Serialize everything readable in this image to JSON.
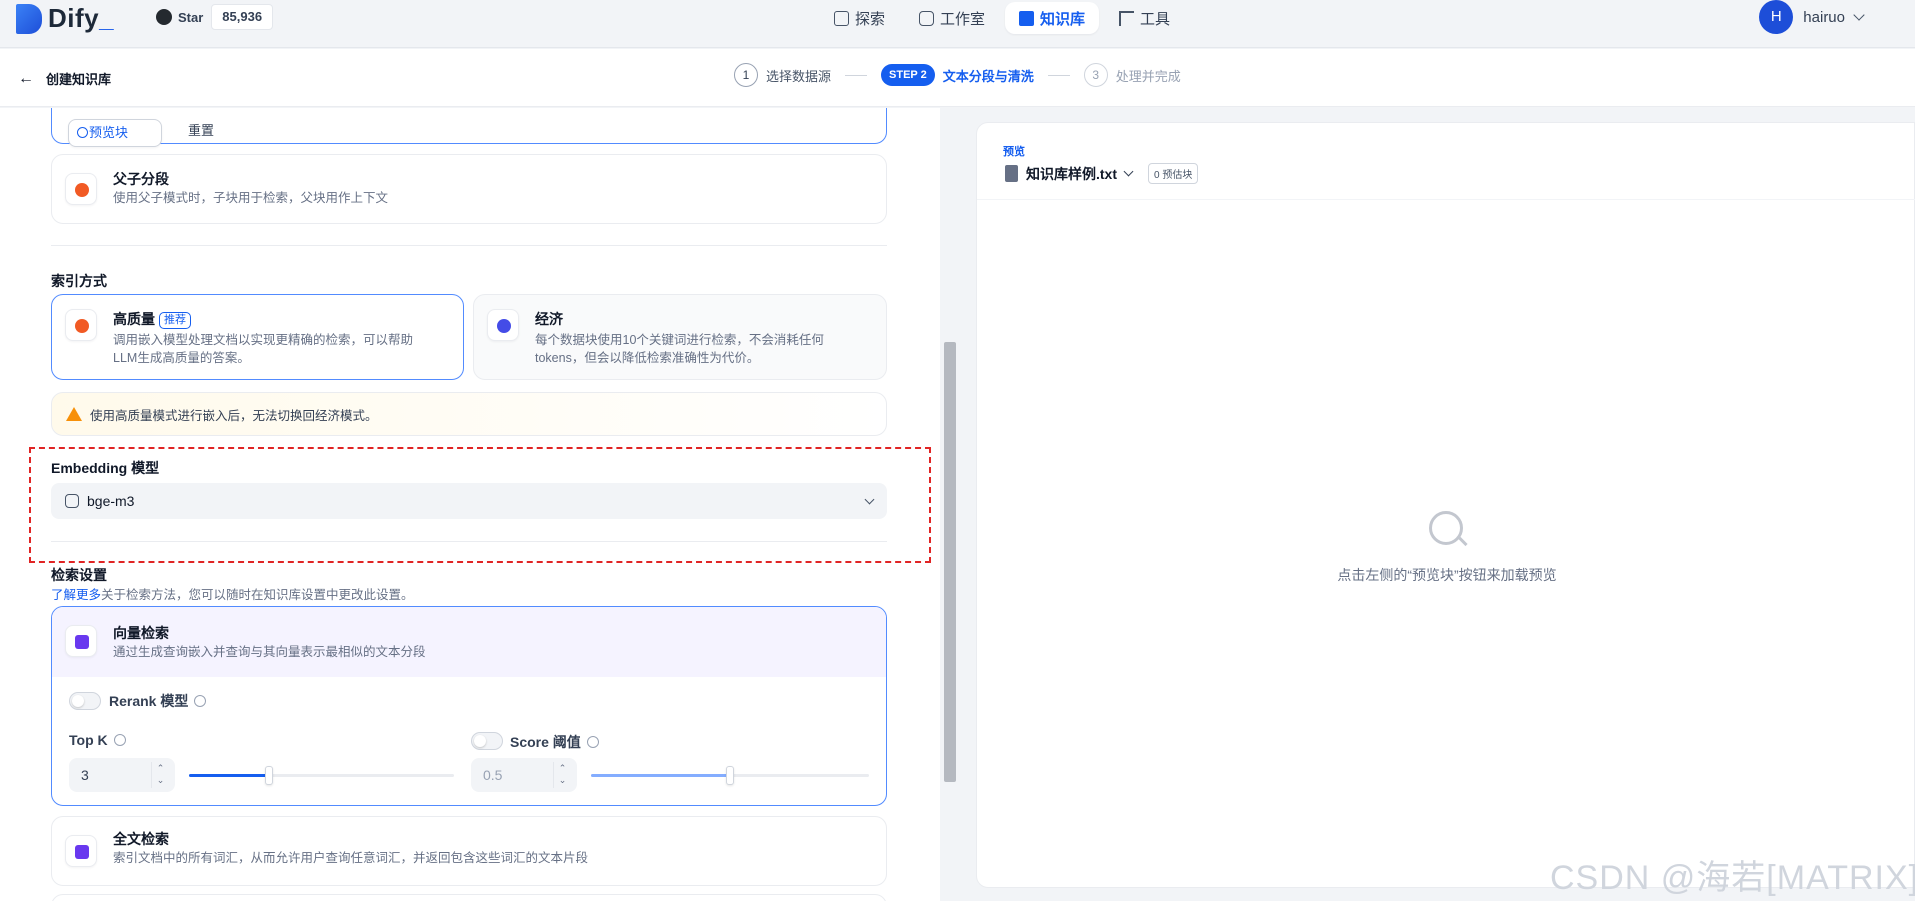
{
  "app": {
    "name": "Dify",
    "underscore": "_"
  },
  "github": {
    "label": "Star",
    "count": "85,936"
  },
  "nav": [
    {
      "label": "探索",
      "icon": "explore-icon"
    },
    {
      "label": "工作室",
      "icon": "robot-icon"
    },
    {
      "label": "知识库",
      "icon": "book-icon",
      "active": true
    },
    {
      "label": "工具",
      "icon": "tool-icon"
    }
  ],
  "user": {
    "initial": "H",
    "name": "hairuo"
  },
  "header": {
    "back_label": "创建知识库"
  },
  "steps": [
    {
      "num": "1",
      "label": "选择数据源"
    },
    {
      "badge": "STEP 2",
      "label": "文本分段与清洗"
    },
    {
      "num": "3",
      "label": "处理并完成"
    }
  ],
  "segment": {
    "preview_button": "预览块",
    "reset_button": "重置",
    "parent_child": {
      "title": "父子分段",
      "desc": "使用父子模式时，子块用于检索，父块用作上下文"
    }
  },
  "index": {
    "title": "索引方式",
    "high_quality": {
      "title": "高质量",
      "badge": "推荐",
      "desc1": "调用嵌入模型处理文档以实现更精确的检索，可以帮助",
      "desc2": "LLM生成高质量的答案。"
    },
    "economy": {
      "title": "经济",
      "desc1": "每个数据块使用10个关键词进行检索，不会消耗任何",
      "desc2": "tokens，但会以降低检索准确性为代价。"
    },
    "warning": "使用高质量模式进行嵌入后，无法切换回经济模式。"
  },
  "embedding": {
    "title": "Embedding 模型",
    "model": "bge-m3"
  },
  "retrieval": {
    "title": "检索设置",
    "learn_more": "了解更多",
    "desc": "关于检索方法，您可以随时在知识库设置中更改此设置。",
    "vector": {
      "title": "向量检索",
      "desc": "通过生成查询嵌入并查询与其向量表示最相似的文本分段"
    },
    "rerank_label": "Rerank 模型",
    "topk_label": "Top K",
    "topk_value": "3",
    "topk_fraction": 0.3,
    "score_label": "Score 阈值",
    "score_value": "0.5",
    "score_fraction": 0.5,
    "fulltext": {
      "title": "全文检索",
      "desc": "索引文档中的所有词汇，从而允许用户查询任意词汇，并返回包含这些词汇的文本片段"
    }
  },
  "preview": {
    "label": "预览",
    "file": "知识库样例.txt",
    "count": "0 预估块",
    "empty_text": "点击左侧的“预览块”按钮来加载预览"
  },
  "watermark": "CSDN @海若[MATRIX]",
  "colors": {
    "accent": "#155eef",
    "warning": "#f79009",
    "highlight_box": "#e02424"
  }
}
